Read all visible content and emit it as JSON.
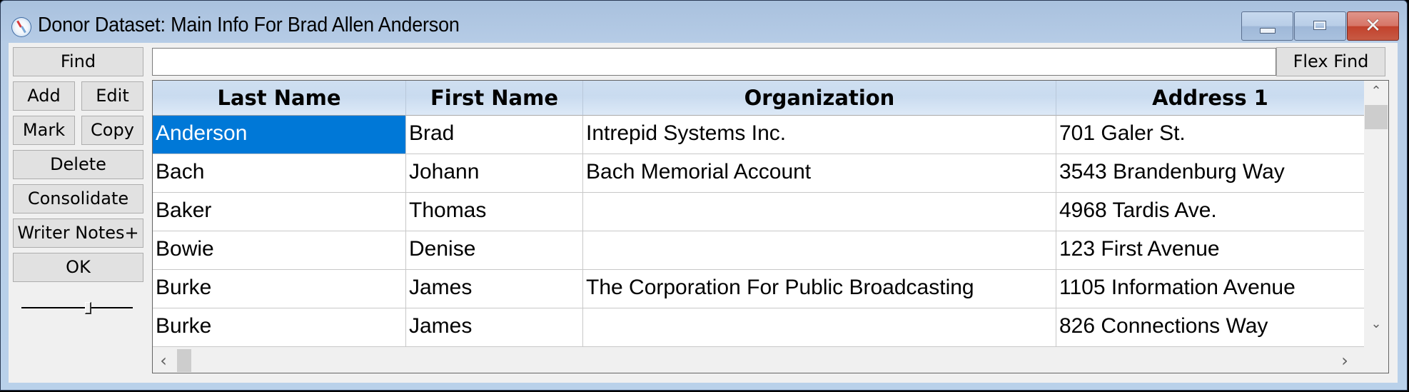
{
  "window": {
    "title": "Donor Dataset: Main Info For Brad Allen Anderson",
    "icon": "compass-icon",
    "controls": {
      "minimize": "minimize-icon",
      "maximize": "maximize-icon",
      "close": "close-icon",
      "close_glyph": "✕"
    }
  },
  "sidebar": {
    "find": "Find",
    "add": "Add",
    "edit": "Edit",
    "mark": "Mark",
    "copy": "Copy",
    "delete": "Delete",
    "consolidate": "Consolidate",
    "writer_notes": "Writer Notes+",
    "ok": "OK",
    "slider_value_fraction": 0.6
  },
  "search": {
    "value": "",
    "placeholder": "",
    "flex_find": "Flex Find"
  },
  "table": {
    "columns": [
      "Last Name",
      "First Name",
      "Organization",
      "Address 1"
    ],
    "rows": [
      {
        "last": "Anderson",
        "first": "Brad",
        "org": "Intrepid Systems Inc.",
        "addr1": "701 Galer St.",
        "selected": true
      },
      {
        "last": "Bach",
        "first": "Johann",
        "org": "Bach Memorial Account",
        "addr1": "3543 Brandenburg Way"
      },
      {
        "last": "Baker",
        "first": "Thomas",
        "org": "",
        "addr1": "4968 Tardis Ave."
      },
      {
        "last": "Bowie",
        "first": "Denise",
        "org": "",
        "addr1": "123 First Avenue"
      },
      {
        "last": "Burke",
        "first": "James",
        "org": "The Corporation For Public Broadcasting",
        "addr1": "1105 Information Avenue"
      },
      {
        "last": "Burke",
        "first": "James",
        "org": "",
        "addr1": "826 Connections Way"
      }
    ],
    "scroll": {
      "up": "⌃",
      "down": "⌄",
      "left": "‹",
      "right": "›"
    },
    "colors": {
      "selection": "#0078d7",
      "header": "#cfdff1"
    }
  }
}
